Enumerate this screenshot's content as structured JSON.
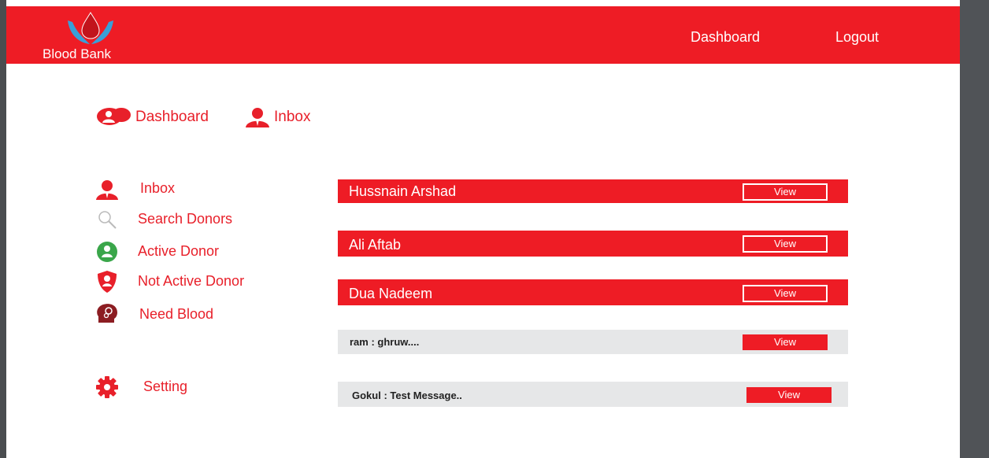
{
  "header": {
    "logo_text": "Blood Bank",
    "nav": {
      "dashboard": "Dashboard",
      "logout": "Logout"
    }
  },
  "breadcrumb": {
    "dashboard": "Dashboard",
    "inbox": "Inbox"
  },
  "sidebar": {
    "items": [
      {
        "label": "Inbox",
        "icon": "person-icon"
      },
      {
        "label": "Search Donors",
        "icon": "search-icon"
      },
      {
        "label": "Active Donor",
        "icon": "active-user-icon"
      },
      {
        "label": "Not Active Donor",
        "icon": "shield-user-icon"
      },
      {
        "label": "Need Blood",
        "icon": "head-icon"
      }
    ],
    "setting": {
      "label": "Setting",
      "icon": "gear-icon"
    }
  },
  "inbox": {
    "donors": [
      {
        "name": "Hussnain Arshad",
        "action": "View"
      },
      {
        "name": "Ali Aftab",
        "action": "View"
      },
      {
        "name": "Dua Nadeem",
        "action": "View"
      }
    ],
    "messages": [
      {
        "text": "ram :  ghruw....",
        "action": "View"
      },
      {
        "text": "Gokul :  Test Message..",
        "action": "View"
      }
    ]
  },
  "colors": {
    "brand_red": "#ee1c25",
    "accent_green": "#3aa64a",
    "row_grey": "#e6e7e8"
  }
}
